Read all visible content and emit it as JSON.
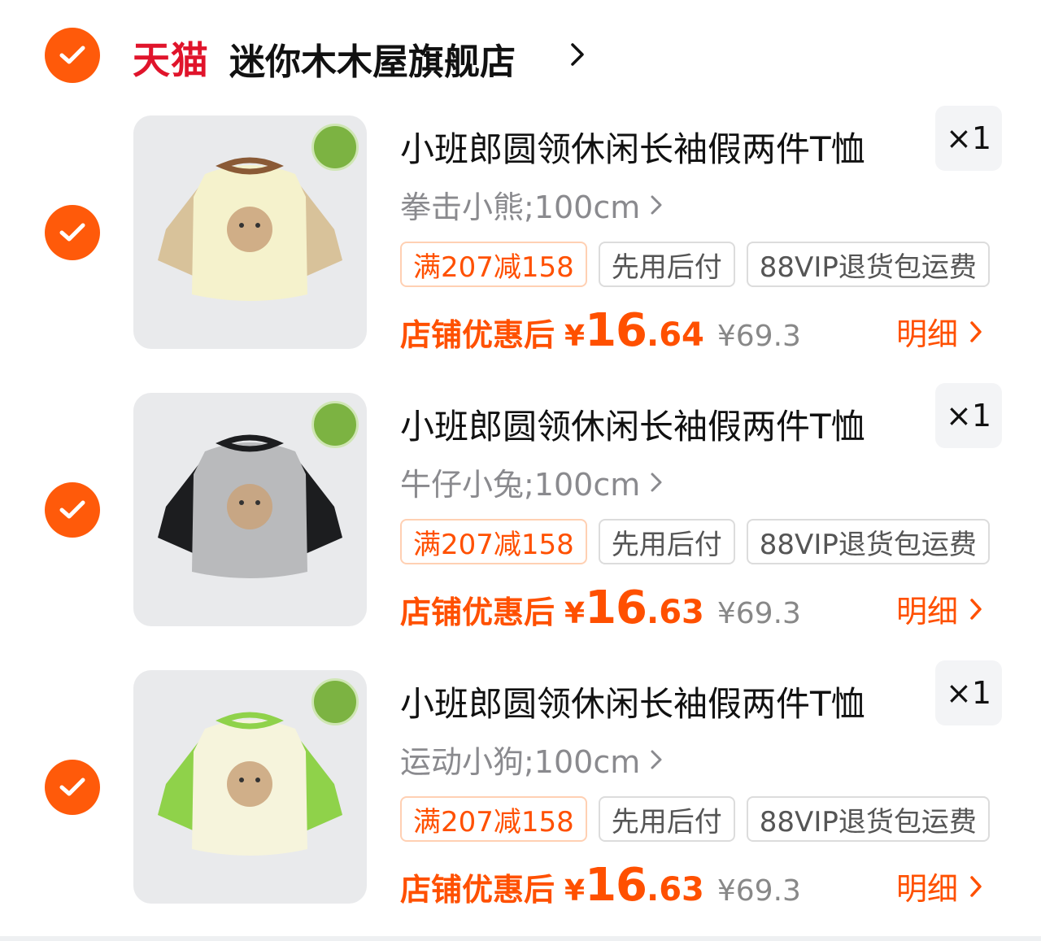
{
  "store": {
    "platform_label": "天猫",
    "name": "迷你木木屋旗舰店"
  },
  "items": [
    {
      "title": "小班郎圆领休闲长袖假两件T恤",
      "quantity": "×1",
      "spec": "拳击小熊;100cm",
      "tags": [
        "满207减158",
        "先用后付",
        "88VIP退货包运费"
      ],
      "price_label": "店铺优惠后",
      "currency": "¥",
      "price_int": "16",
      "price_dec": ".64",
      "original_price": "¥69.3",
      "detail_label": "明细",
      "shirt_colors": {
        "body": "#f5f2cc",
        "sleeve": "#d8c29a",
        "collar": "#8a5a36"
      }
    },
    {
      "title": "小班郎圆领休闲长袖假两件T恤",
      "quantity": "×1",
      "spec": "牛仔小兔;100cm",
      "tags": [
        "满207减158",
        "先用后付",
        "88VIP退货包运费"
      ],
      "price_label": "店铺优惠后",
      "currency": "¥",
      "price_int": "16",
      "price_dec": ".63",
      "original_price": "¥69.3",
      "detail_label": "明细",
      "shirt_colors": {
        "body": "#b9babc",
        "sleeve": "#1c1d1f",
        "collar": "#1c1d1f"
      }
    },
    {
      "title": "小班郎圆领休闲长袖假两件T恤",
      "quantity": "×1",
      "spec": "运动小狗;100cm",
      "tags": [
        "满207减158",
        "先用后付",
        "88VIP退货包运费"
      ],
      "price_label": "店铺优惠后",
      "currency": "¥",
      "price_int": "16",
      "price_dec": ".63",
      "original_price": "¥69.3",
      "detail_label": "明细",
      "shirt_colors": {
        "body": "#f6f4dc",
        "sleeve": "#8fd24a",
        "collar": "#8fd24a"
      }
    }
  ],
  "colors": {
    "accent": "#ff5000",
    "check": "#ff5a0a",
    "tmall": "#e0142b"
  }
}
